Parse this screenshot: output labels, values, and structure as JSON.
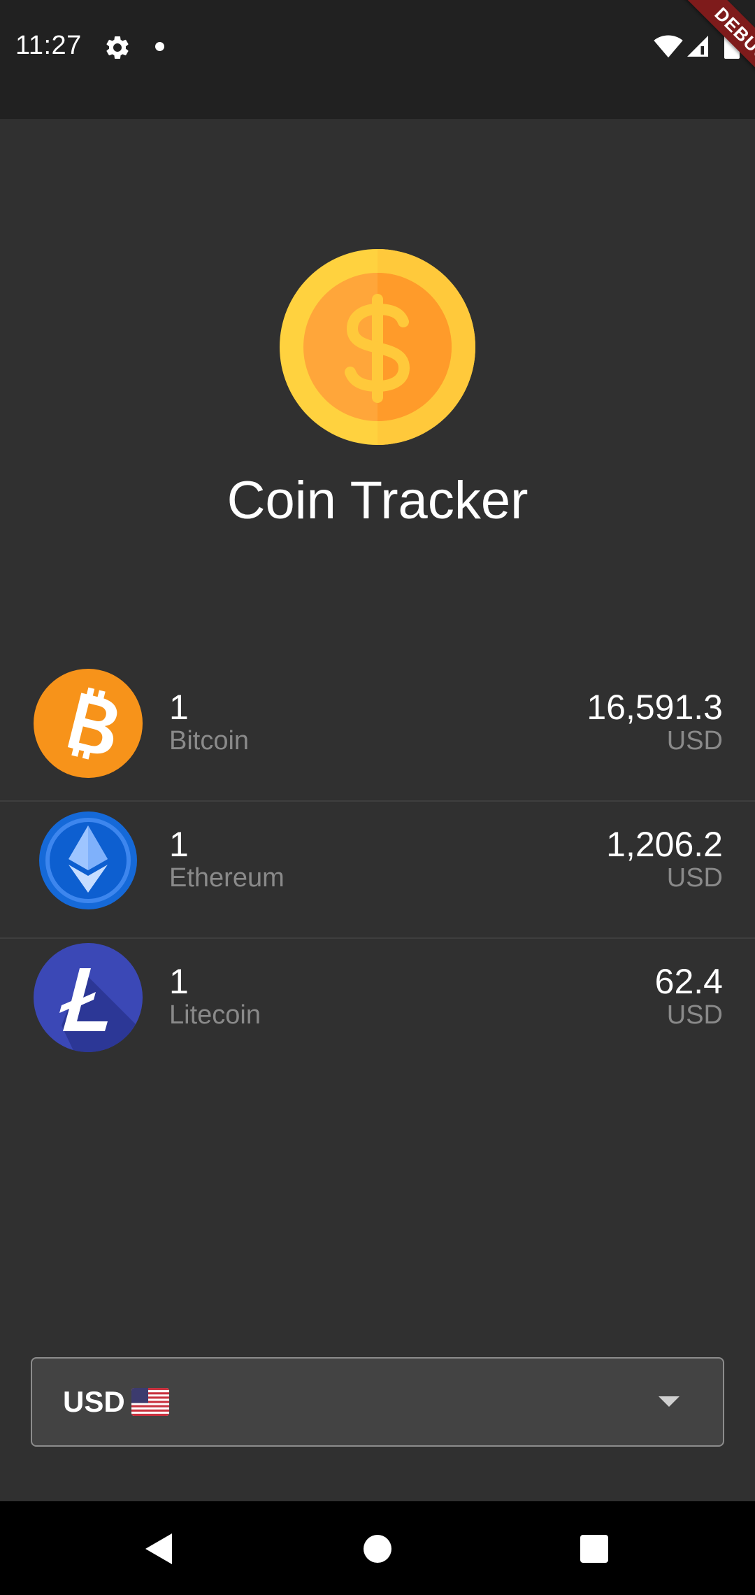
{
  "status_bar": {
    "time": "11:27",
    "icons": [
      "gear-icon",
      "notification-dot-icon",
      "wifi-icon",
      "cell-signal-icon",
      "battery-icon"
    ]
  },
  "debug_banner": {
    "label": "DEBUG"
  },
  "header": {
    "title": "Coin Tracker",
    "logo_icon": "gold-coin-dollar-icon"
  },
  "coins": [
    {
      "amount": "1",
      "name": "Bitcoin",
      "price": "16,591.3",
      "currency": "USD",
      "icon": "bitcoin-icon",
      "color": "#f7931a"
    },
    {
      "amount": "1",
      "name": "Ethereum",
      "price": "1,206.2",
      "currency": "USD",
      "icon": "ethereum-icon",
      "color": "#1569d8"
    },
    {
      "amount": "1",
      "name": "Litecoin",
      "price": "62.4",
      "currency": "USD",
      "icon": "litecoin-icon",
      "color": "#3b48b6"
    }
  ],
  "currency_select": {
    "selected": "USD",
    "flag_icon": "us-flag-icon"
  },
  "nav_bar": {
    "icons": [
      "back-icon",
      "home-icon",
      "recents-icon"
    ]
  },
  "colors": {
    "background": "#303030",
    "status_bar": "#212121",
    "secondary_text": "#8a8a8a",
    "debug_ribbon": "#7e1b1b"
  }
}
